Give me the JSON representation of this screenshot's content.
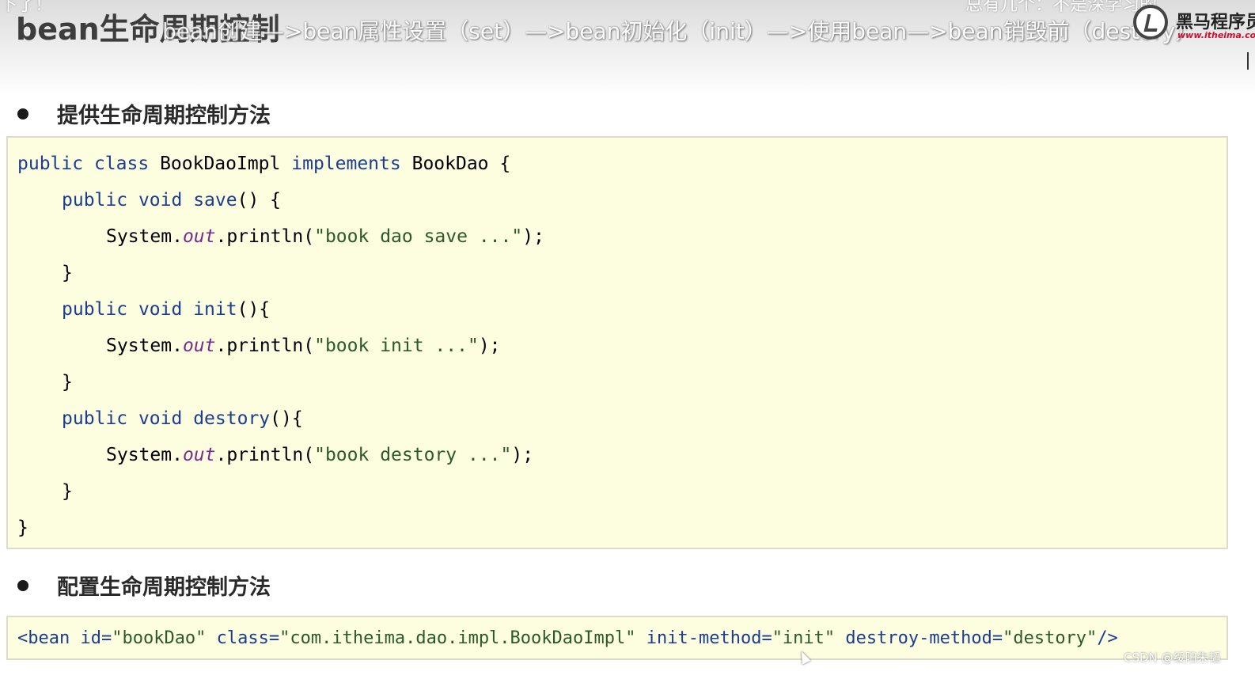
{
  "slide": {
    "title": "bean生命周期控制",
    "lifecycle_overlay": "bean创建—>bean属性设置（set）—>bean初始化（init）—>使用bean—>bean销毁前（destory）",
    "danmaku_left": "下了！",
    "danmaku_right": "总有几个：不是深学习的"
  },
  "logo": {
    "name": "黑马程序员",
    "url": "www.itheima.com",
    "icon": "itheima-logo-icon"
  },
  "sections": [
    {
      "title": "提供生命周期控制方法"
    },
    {
      "title": "配置生命周期控制方法"
    }
  ],
  "java_code": {
    "class_decl": {
      "kw1": "public",
      "kw2": "class",
      "name": "BookDaoImpl",
      "kw3": "implements",
      "iface": "BookDao",
      "brace": "{"
    },
    "methods": [
      {
        "kw1": "public",
        "kw2": "void",
        "name": "save",
        "sig": "() {",
        "sys": "System.",
        "out": "out",
        "call": ".println(",
        "str": "\"book dao save ...\"",
        "end": ");",
        "close": "}"
      },
      {
        "kw1": "public",
        "kw2": "void",
        "name": "init",
        "sig": "(){",
        "sys": "System.",
        "out": "out",
        "call": ".println(",
        "str": "\"book init ...\"",
        "end": ");",
        "close": "}"
      },
      {
        "kw1": "public",
        "kw2": "void",
        "name": "destory",
        "sig": "(){",
        "sys": "System.",
        "out": "out",
        "call": ".println(",
        "str": "\"book destory ...\"",
        "end": ");",
        "close": "}"
      }
    ],
    "class_close": "}"
  },
  "xml_config": {
    "open": "<bean",
    "attr_id": " id=",
    "val_id": "\"bookDao\"",
    "attr_class": " class=",
    "val_class": "\"com.itheima.dao.impl.BookDaoImpl\"",
    "attr_init": " init-method=",
    "val_init": "\"init\"",
    "attr_destroy": " destroy-method=",
    "val_destroy": "\"destory\"",
    "close": "/>"
  },
  "watermark": "CSDN @绥阳朱韬"
}
